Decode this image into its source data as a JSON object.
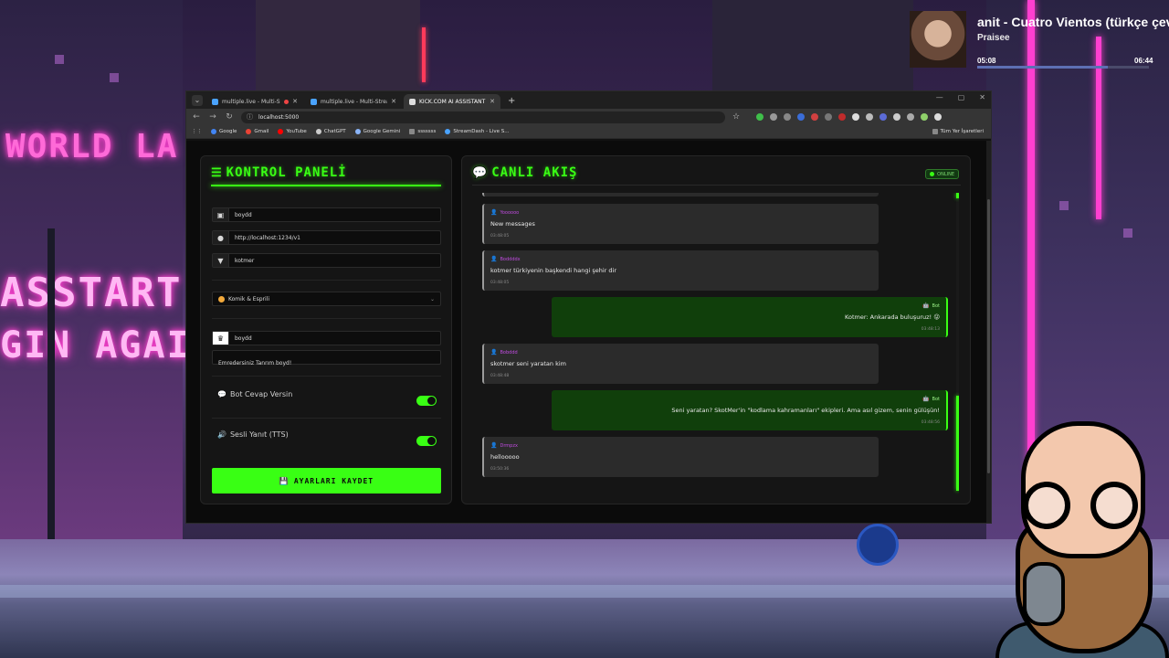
{
  "music": {
    "title": "anit - Cuatro Vientos (türkçe çeviri",
    "artist": "Praisee",
    "current_time": "05:08",
    "total_time": "06:44",
    "progress": 0.76,
    "album_icon": "album-cover-icon"
  },
  "browser": {
    "tabs": [
      {
        "label": "multiple.live - Multi-Stream",
        "active": false,
        "recording": true
      },
      {
        "label": "multiple.live - Multi-Stream Da",
        "active": false,
        "recording": false
      },
      {
        "label": "KICK.COM AI ASSISTANT",
        "active": true,
        "recording": false
      }
    ],
    "address": "localhost:5000",
    "bookmarks": [
      {
        "label": "Google",
        "color": "#4285f4"
      },
      {
        "label": "Gmail",
        "color": "#ea4335"
      },
      {
        "label": "YouTube",
        "color": "#ff0000"
      },
      {
        "label": "ChatGPT",
        "color": "#cccccc"
      },
      {
        "label": "Google Gemini",
        "color": "#8ab4f8"
      },
      {
        "label": "sssssss",
        "color": "#888888"
      },
      {
        "label": "StreamDash - Live S...",
        "color": "#4aa3ff"
      }
    ],
    "bookmarks_right": "Tüm Yer İşaretleri"
  },
  "control_panel": {
    "title": "KONTROL PANELİ",
    "fields": {
      "channel": {
        "value": "boydd",
        "icon": "user-card-icon"
      },
      "api_url": {
        "value": "http://localhost:1234/v1",
        "icon": "globe-icon"
      },
      "filter": {
        "value": "kotmer",
        "icon": "filter-icon"
      }
    },
    "personality": {
      "value": "Komik & Esprili",
      "icon": "laughing-emoji-icon"
    },
    "owner": {
      "value": "boydd",
      "icon": "crown-icon"
    },
    "owner_message": {
      "value": "Emredersiniz Tanrım boyd!"
    },
    "toggles": {
      "bot_reply": {
        "label": "Bot Cevap Versin",
        "on": true,
        "icon": "chat-bubble-icon"
      },
      "tts": {
        "label": "Sesli Yanıt (TTS)",
        "on": true,
        "icon": "speaker-icon"
      }
    },
    "save_label": "AYARLARI KAYDET",
    "save_icon": "floppy-disk-icon",
    "accent": "#39ff14"
  },
  "live_feed": {
    "title": "CANLI AKIŞ",
    "badge": "ONLINE",
    "messages": [
      {
        "type": "user",
        "author": "Yoooooo",
        "text": "New messages",
        "time": "03:48:05"
      },
      {
        "type": "user",
        "author": "Boddddx",
        "text": "kotmer türkiyenin başkendi hangi şehir dir",
        "time": "03:48:05"
      },
      {
        "type": "bot",
        "author": "Bot",
        "text": "Kotmer: Ankarada buluşuruz! 😜",
        "time": "03:48:13"
      },
      {
        "type": "user",
        "author": "Bobddd",
        "text": "skotmer seni yaratan kim",
        "time": "03:48:48"
      },
      {
        "type": "bot",
        "author": "Bot",
        "text": "Seni yaratan? SkotMer'in \"kodlama kahramanları\" ekipleri. Ama asıl gizem, senin gülüşün!",
        "time": "03:48:56"
      },
      {
        "type": "user",
        "author": "Drmpzx",
        "text": "hellooooo",
        "time": "03:50:36"
      }
    ]
  }
}
